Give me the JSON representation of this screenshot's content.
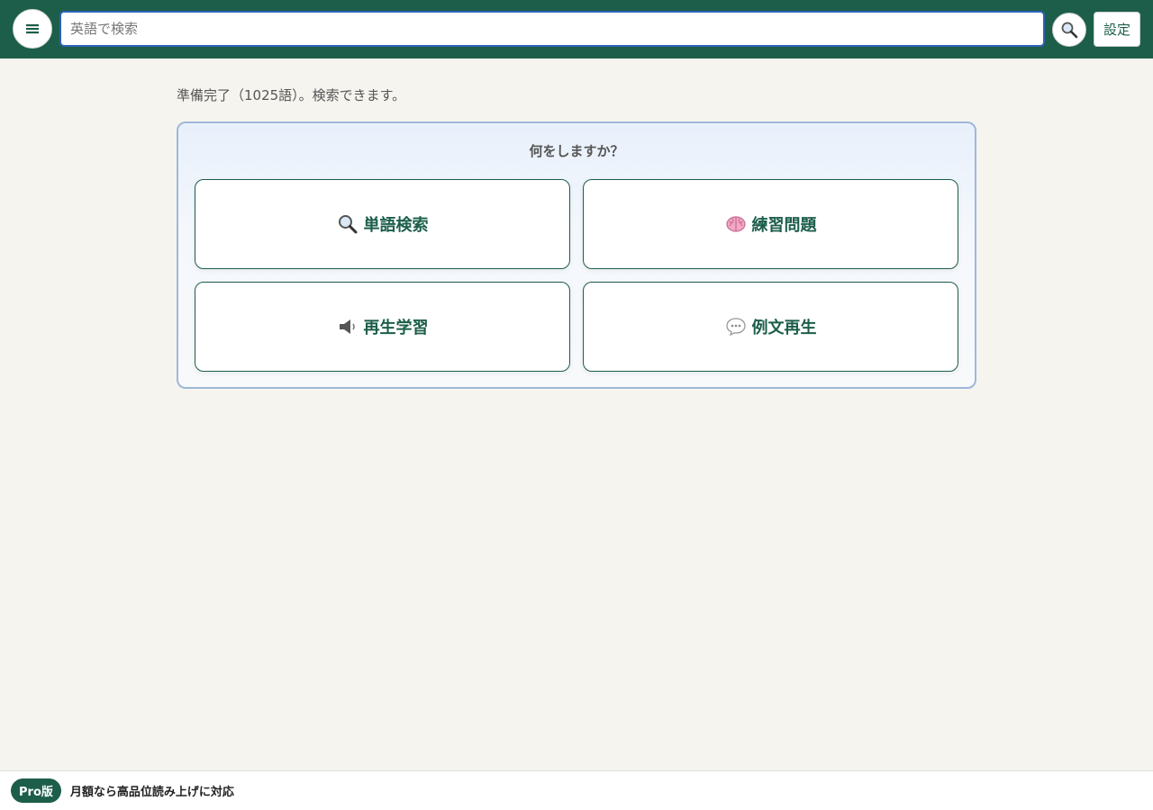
{
  "header": {
    "search_placeholder": "英語で検索",
    "settings_label": "設定",
    "accent": "#1c5e4a"
  },
  "status": {
    "text": "準備完了（1025語）。検索できます。"
  },
  "panel": {
    "title": "何をしますか？",
    "actions": [
      {
        "label": "単語検索",
        "icon": "magnifier-icon"
      },
      {
        "label": "練習問題",
        "icon": "brain-icon"
      },
      {
        "label": "再生学習",
        "icon": "speaker-icon"
      },
      {
        "label": "例文再生",
        "icon": "speech-bubble-icon"
      }
    ]
  },
  "footer": {
    "badge": "Pro版",
    "text": "月額なら高品位読み上げに対応"
  }
}
